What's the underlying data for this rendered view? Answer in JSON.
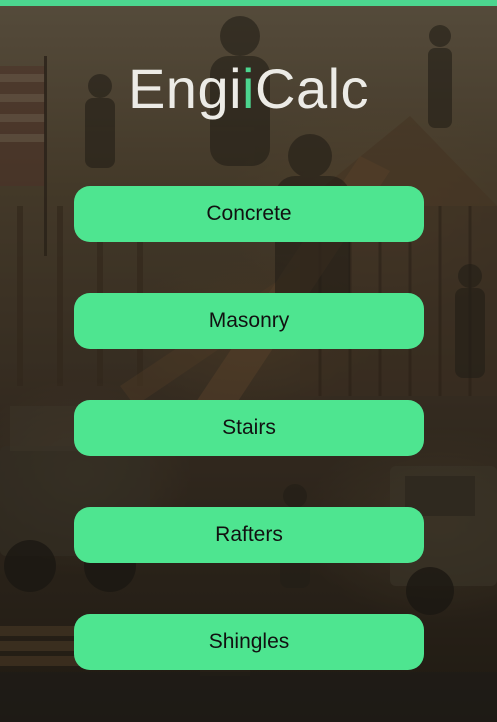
{
  "app": {
    "title_part1": "Engi",
    "title_accent": "i",
    "title_part2": "Calc",
    "accent_color": "#4cd68f",
    "button_color": "#4ee590"
  },
  "menu": {
    "items": [
      {
        "label": "Concrete"
      },
      {
        "label": "Masonry"
      },
      {
        "label": "Stairs"
      },
      {
        "label": "Rafters"
      },
      {
        "label": "Shingles"
      }
    ]
  }
}
